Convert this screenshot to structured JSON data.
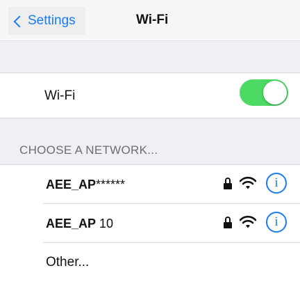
{
  "navbar": {
    "back_label": "Settings",
    "title": "Wi-Fi"
  },
  "wifi_toggle": {
    "label": "Wi-Fi",
    "state": "on",
    "on_color": "#4cd964"
  },
  "section_header": "CHOOSE A NETWORK...",
  "networks": [
    {
      "name_prefix": "AEE_AP",
      "name_suffix": "******",
      "secured": true,
      "icons": [
        "lock-icon",
        "wifi-signal-icon",
        "info-icon"
      ],
      "info_symbol": "i"
    },
    {
      "name_prefix": "AEE_AP",
      "name_suffix": " 10",
      "secured": true,
      "icons": [
        "lock-icon",
        "wifi-signal-icon",
        "info-icon"
      ],
      "info_symbol": "i"
    }
  ],
  "other_label": "Other...",
  "colors": {
    "accent": "#1a7cf4",
    "background": "#efeff4"
  }
}
